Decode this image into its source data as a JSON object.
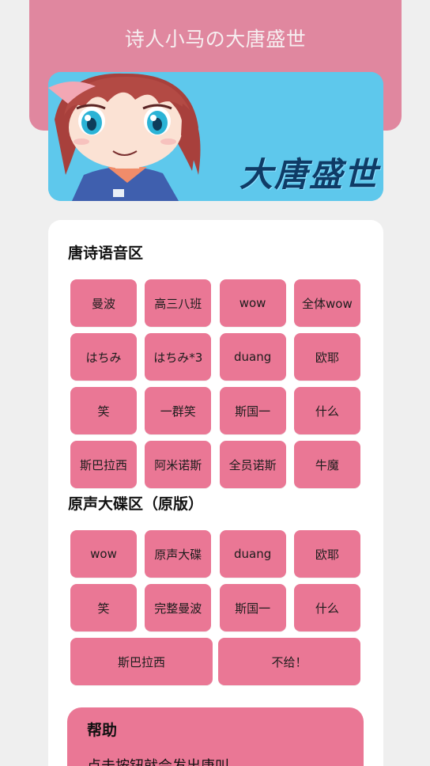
{
  "header": {
    "title": "诗人小马の大唐盛世"
  },
  "banner": {
    "text": "大唐盛世"
  },
  "section_poems": {
    "title": "唐诗语音区",
    "buttons": [
      "曼波",
      "高三八班",
      "wow",
      "全体wow",
      "はちみ",
      "はちみ*3",
      "duang",
      "欧耶",
      "笑",
      "一群笑",
      "斯国一",
      "什么",
      "斯巴拉西",
      "阿米诺斯",
      "全员诺斯",
      "牛魔"
    ]
  },
  "section_original": {
    "title": "原声大碟区（原版）",
    "buttons": [
      "wow",
      "原声大碟",
      "duang",
      "欧耶",
      "笑",
      "完整曼波",
      "斯国一",
      "什么"
    ],
    "wide_buttons": [
      "斯巴拉西",
      "不给！"
    ]
  },
  "help": {
    "title": "帮助",
    "text": "点击按钮就会发出唐叫"
  },
  "colors": {
    "header_bg": "#e0879f",
    "button_bg": "#ea7795",
    "banner_bg": "#5ec8ec",
    "page_bg": "#efefef"
  }
}
